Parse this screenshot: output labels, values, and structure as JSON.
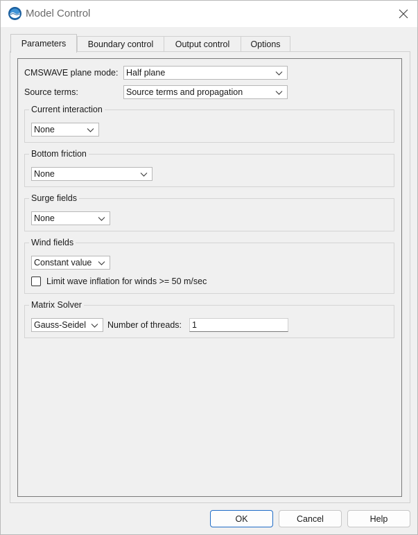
{
  "window": {
    "title": "Model Control"
  },
  "tabs": [
    {
      "label": "Parameters",
      "active": true
    },
    {
      "label": "Boundary control"
    },
    {
      "label": "Output control"
    },
    {
      "label": "Options"
    }
  ],
  "params": {
    "plane_mode_label": "CMSWAVE plane mode:",
    "plane_mode_value": "Half plane",
    "source_terms_label": "Source terms:",
    "source_terms_value": "Source terms and propagation"
  },
  "current_interaction": {
    "title": "Current interaction",
    "value": "None"
  },
  "bottom_friction": {
    "title": "Bottom friction",
    "value": "None"
  },
  "surge_fields": {
    "title": "Surge fields",
    "value": "None"
  },
  "wind_fields": {
    "title": "Wind fields",
    "value": "Constant value",
    "limit_label": "Limit wave inflation for winds >= 50 m/sec",
    "limit_checked": false
  },
  "matrix_solver": {
    "title": "Matrix Solver",
    "solver_value": "Gauss-Seidel",
    "threads_label": "Number of threads:",
    "threads_value": "1"
  },
  "buttons": {
    "ok": "OK",
    "cancel": "Cancel",
    "help": "Help"
  },
  "colors": {
    "accent": "#1f6cc7",
    "background": "#f0f0f0"
  }
}
